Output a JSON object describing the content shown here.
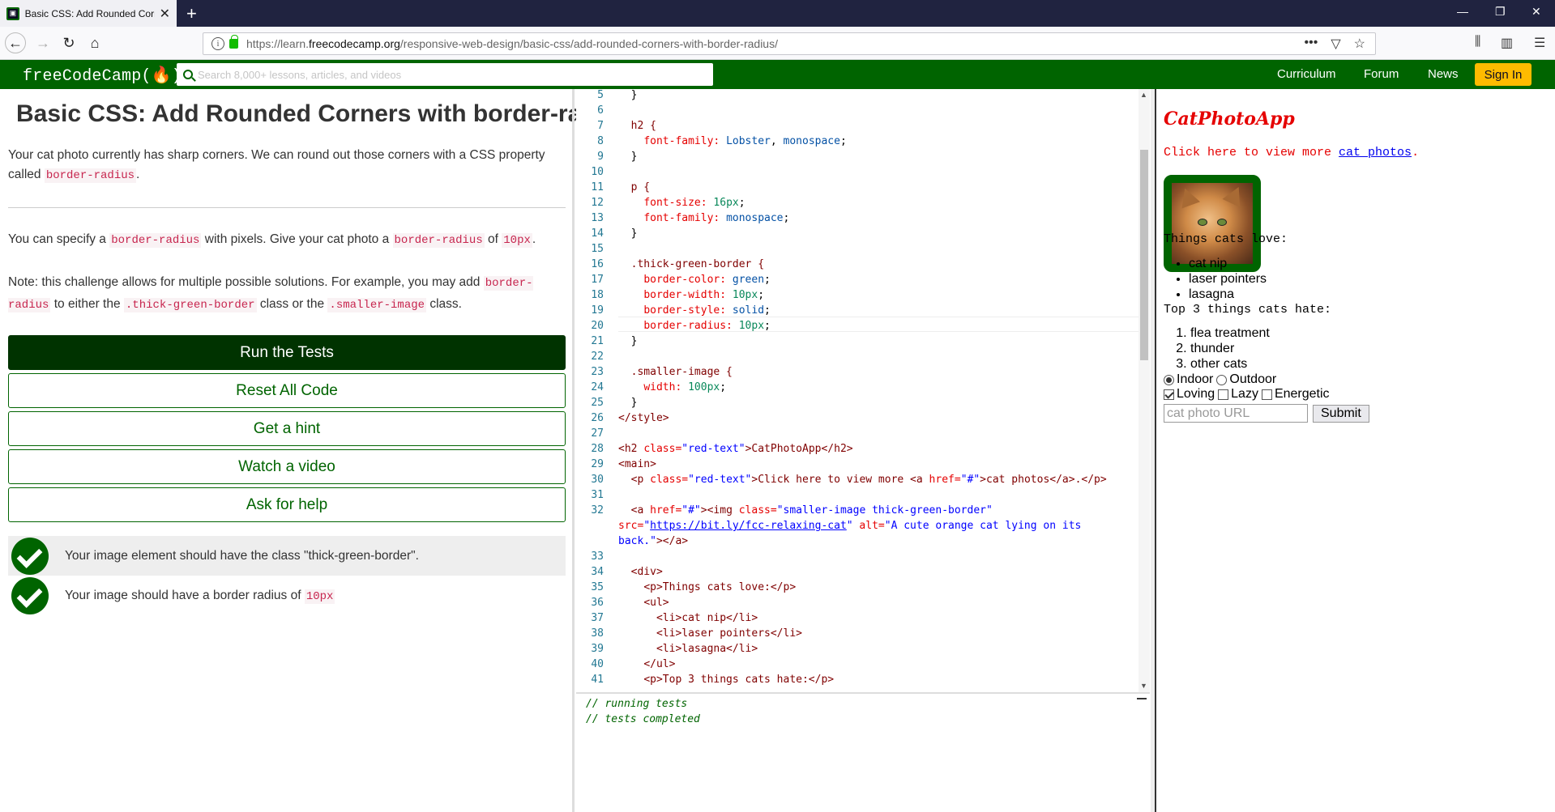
{
  "browser": {
    "tab_title": "Basic CSS: Add Rounded Corne",
    "tab_close": "✕",
    "new_tab": "+",
    "url_prefix": "https://learn.",
    "url_domain": "freecodecamp.org",
    "url_path": "/responsive-web-design/basic-css/add-rounded-corners-with-border-radius/",
    "url_actions": "•••",
    "nav_back": "←",
    "nav_forward": "→",
    "nav_reload": "↻",
    "nav_home": "⌂",
    "minimize": "—",
    "restore": "❐",
    "close": "✕"
  },
  "header": {
    "logo": "freeCodeCamp(🔥)",
    "search_placeholder": "Search 8,000+ lessons, articles, and videos",
    "nav": [
      "Curriculum",
      "Forum",
      "News"
    ],
    "signin": "Sign In"
  },
  "lesson": {
    "title": "Basic CSS: Add Rounded Corners with border-radius",
    "p1_a": "Your cat photo currently has sharp corners. We can round out those corners with a CSS property called ",
    "p1_code": "border-radius",
    "p1_b": ".",
    "p2_a": "You can specify a ",
    "p2_code1": "border-radius",
    "p2_b": " with pixels. Give your cat photo a ",
    "p2_code2": "border-radius",
    "p2_c": " of ",
    "p2_code3": "10px",
    "p2_d": ".",
    "p3_a": "Note: this challenge allows for multiple possible solutions. For example, you may add ",
    "p3_code1": "border-radius",
    "p3_b": " to either the ",
    "p3_code2": ".thick-green-border",
    "p3_c": " class or the ",
    "p3_code3": ".smaller-image",
    "p3_d": " class.",
    "buttons": {
      "run": "Run the Tests",
      "reset": "Reset All Code",
      "hint": "Get a hint",
      "video": "Watch a video",
      "help": "Ask for help"
    },
    "tests": {
      "t1": "Your image element should have the class \"thick-green-border\".",
      "t2_a": "Your image should have a border radius of ",
      "t2_code": "10px"
    }
  },
  "editor": {
    "line_numbers": [
      "5",
      "6",
      "7",
      "8",
      "9",
      "10",
      "11",
      "12",
      "13",
      "14",
      "15",
      "16",
      "17",
      "18",
      "19",
      "20",
      "21",
      "22",
      "23",
      "24",
      "25",
      "26",
      "27",
      "28",
      "29",
      "30",
      "31",
      "32",
      "",
      "",
      "33",
      "34",
      "35",
      "36",
      "37",
      "38",
      "39",
      "40",
      "41"
    ],
    "l5": "}",
    "l7": "h2 {",
    "l8_p": "font-family:",
    "l8_v1": "Lobster",
    "l8_c": ",",
    "l8_v2": "monospace",
    "l8_e": ";",
    "l9": "}",
    "l11": "p {",
    "l12_p": "font-size:",
    "l12_v": "16px",
    "l12_e": ";",
    "l13_p": "font-family:",
    "l13_v": "monospace",
    "l13_e": ";",
    "l14": "}",
    "l16": ".thick-green-border {",
    "l17_p": "border-color:",
    "l17_v": "green",
    "l17_e": ";",
    "l18_p": "border-width:",
    "l18_v": "10px",
    "l18_e": ";",
    "l19_p": "border-style:",
    "l19_v": "solid",
    "l19_e": ";",
    "l20_p": "border-radius:",
    "l20_v": "10px",
    "l20_e": ";",
    "l21": "}",
    "l23": ".smaller-image {",
    "l24_p": "width:",
    "l24_v": "100px",
    "l24_e": ";",
    "l25": "}",
    "l26": "</style>",
    "l28_a": "<h2 ",
    "l28_attr": "class=",
    "l28_str": "\"red-text\"",
    "l28_b": ">CatPhotoApp</h2>",
    "l29": "<main>",
    "l30_a": "<p ",
    "l30_attr": "class=",
    "l30_str": "\"red-text\"",
    "l30_b": ">Click here to view more <a ",
    "l30_attr2": "href=",
    "l30_str2": "\"#\"",
    "l30_c": ">cat photos</a>.</p>",
    "l32_a": "<a ",
    "l32_attr": "href=",
    "l32_str": "\"#\"",
    "l32_b": "><img ",
    "l32_attr2": "class=",
    "l32_str2": "\"smaller-image thick-green-border\"",
    "l32w1_attr": "src=",
    "l32w1_q1": "\"",
    "l32w1_link": "https://bit.ly/fcc-relaxing-cat",
    "l32w1_q2": "\"",
    "l32w1_attr2": " alt=",
    "l32w1_str": "\"A cute orange cat lying on its",
    "l32w2_str": "back.\"",
    "l32w2_end": "></a>",
    "l34": "<div>",
    "l35": "<p>Things cats love:</p>",
    "l36": "<ul>",
    "l37": "<li>cat nip</li>",
    "l38": "<li>laser pointers</li>",
    "l39": "<li>lasagna</li>",
    "l40": "</ul>",
    "l41": "<p>Top 3 things cats hate:</p>"
  },
  "console": {
    "line1": "// running tests",
    "line2": "// tests completed"
  },
  "preview": {
    "title": "CatPhotoApp",
    "click_a": "Click here to view more ",
    "click_link": "cat photos",
    "click_b": ".",
    "img_alt": "A cute orange cat lying on its back.",
    "love_heading": "Things cats love:",
    "love_items": [
      "cat nip",
      "laser pointers",
      "lasagna"
    ],
    "hate_heading": "Top 3 things cats hate:",
    "hate_items": [
      "flea treatment",
      "thunder",
      "other cats"
    ],
    "radio_indoor": "Indoor",
    "radio_outdoor": "Outdoor",
    "cb_loving": "Loving",
    "cb_lazy": "Lazy",
    "cb_energetic": "Energetic",
    "url_placeholder": "cat photo URL",
    "submit": "Submit"
  }
}
